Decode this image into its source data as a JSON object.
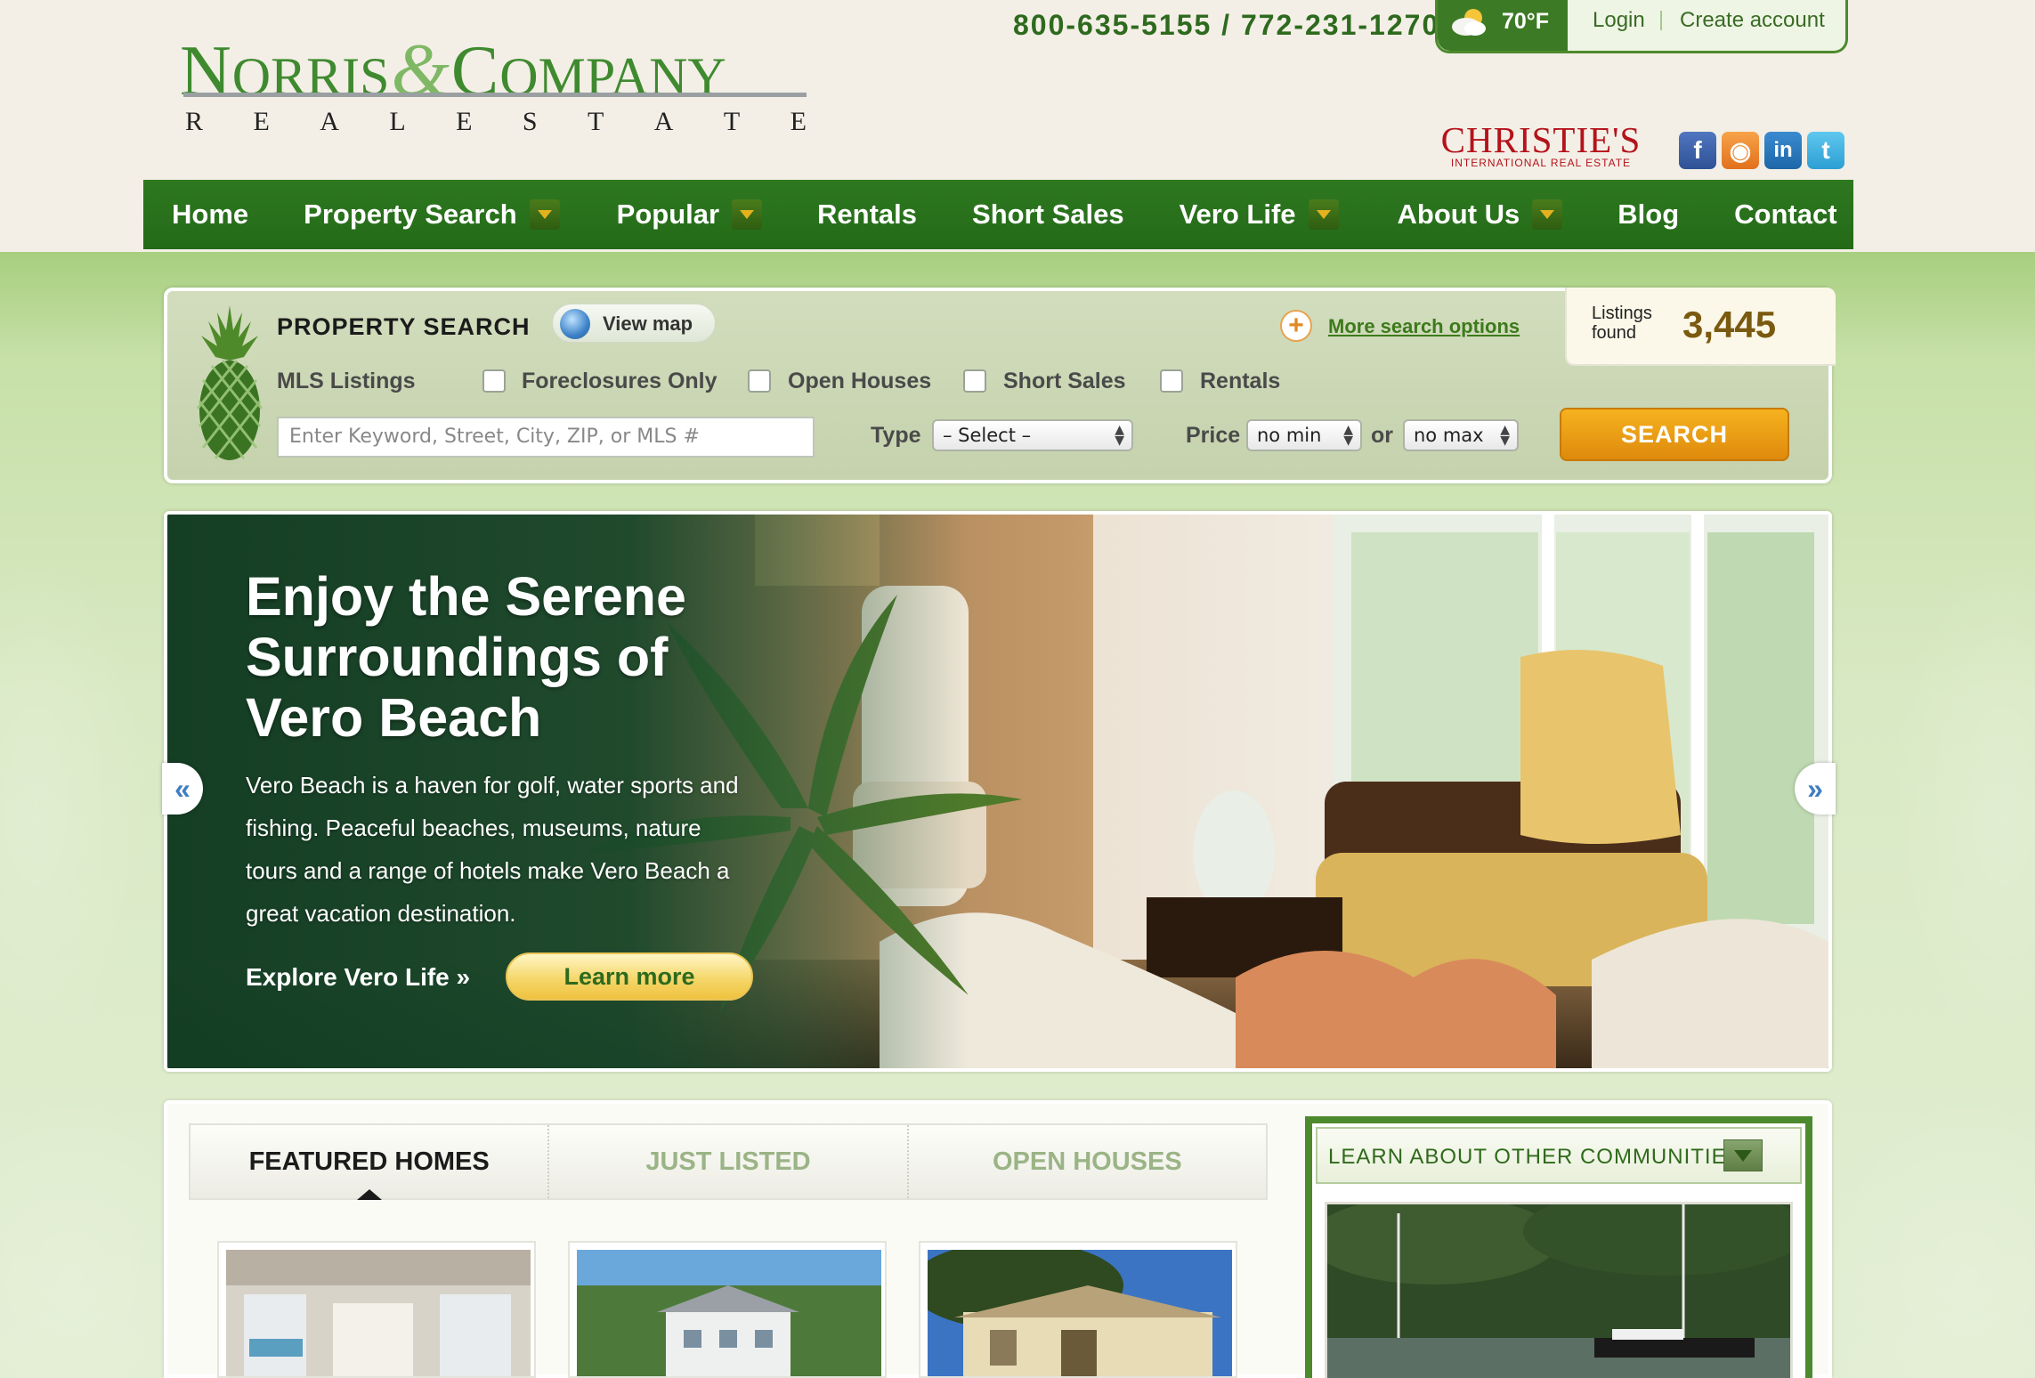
{
  "header": {
    "logo": {
      "part1_big": "N",
      "part1_small": "ORRIS",
      "amp": "&",
      "part2_big": "C",
      "part2_small": "OMPANY",
      "sub_letters": [
        "R",
        "E",
        "A",
        "L",
        "E",
        "S",
        "T",
        "A",
        "T",
        "E"
      ]
    },
    "phone": "800-635-5155 / 772-231-1270",
    "weather": {
      "temp": "70°F",
      "icon": "partly-cloudy-icon"
    },
    "login_label": "Login",
    "create_account_label": "Create account",
    "christies": {
      "name": "CHRISTIE'S",
      "tagline": "INTERNATIONAL REAL ESTATE"
    },
    "social": [
      {
        "name": "facebook",
        "glyph": "f"
      },
      {
        "name": "rss",
        "glyph": "◉"
      },
      {
        "name": "linkedin",
        "glyph": "in"
      },
      {
        "name": "twitter",
        "glyph": "t"
      }
    ]
  },
  "nav": {
    "items": [
      {
        "label": "Home",
        "dropdown": false
      },
      {
        "label": "Property Search",
        "dropdown": true
      },
      {
        "label": "Popular",
        "dropdown": true
      },
      {
        "label": "Rentals",
        "dropdown": false
      },
      {
        "label": "Short Sales",
        "dropdown": false
      },
      {
        "label": "Vero Life",
        "dropdown": true
      },
      {
        "label": "About Us",
        "dropdown": true
      },
      {
        "label": "Blog",
        "dropdown": false
      },
      {
        "label": "Contact",
        "dropdown": false
      }
    ]
  },
  "search": {
    "title": "PROPERTY SEARCH",
    "view_map_label": "View map",
    "more_options_label": "More search options",
    "listings_found_label": "Listings found",
    "listings_count": "3,445",
    "mls_label": "MLS Listings",
    "checkboxes": [
      "Foreclosures Only",
      "Open Houses",
      "Short Sales",
      "Rentals"
    ],
    "keyword_placeholder": "Enter Keyword, Street, City, ZIP, or MLS #",
    "type_label": "Type",
    "type_value": "– Select –",
    "price_label": "Price",
    "price_min": "no min",
    "or_label": "or",
    "price_max": "no max",
    "search_button": "SEARCH"
  },
  "hero": {
    "title": "Enjoy the Serene Surroundings of Vero Beach",
    "description": "Vero Beach is a haven for golf, water sports and fishing. Peaceful beaches, museums, nature tours and a range of hotels make Vero Beach a great vacation destination.",
    "explore_label": "Explore Vero Life »",
    "learn_more_label": "Learn more",
    "prev_label": "«",
    "next_label": "»"
  },
  "listings": {
    "tabs": [
      "FEATURED HOMES",
      "JUST LISTED",
      "OPEN HOUSES"
    ],
    "active_tab": "FEATURED HOMES"
  },
  "communities": {
    "heading": "LEARN ABOUT OTHER COMMUNITIES"
  },
  "colors": {
    "brand_green": "#2e7820",
    "accent_orange": "#de8a0c",
    "christies_red": "#b5121b"
  }
}
